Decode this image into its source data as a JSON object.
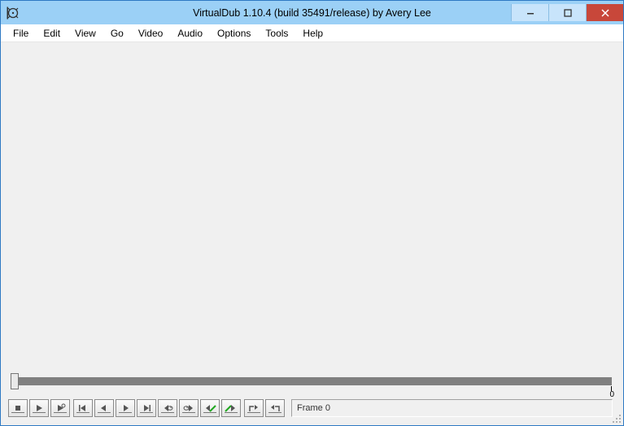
{
  "window": {
    "title": "VirtualDub 1.10.4 (build 35491/release) by Avery Lee"
  },
  "menu": {
    "items": [
      "File",
      "Edit",
      "View",
      "Go",
      "Video",
      "Audio",
      "Options",
      "Tools",
      "Help"
    ]
  },
  "timeline": {
    "end_label": "0"
  },
  "toolbar": {
    "buttons": [
      "stop",
      "play-input",
      "play-output",
      "go-start",
      "step-back",
      "step-forward",
      "go-end",
      "key-prev",
      "key-next",
      "scene-prev",
      "scene-next",
      "mark-in",
      "mark-out"
    ]
  },
  "status": {
    "frame_label": "Frame 0"
  }
}
